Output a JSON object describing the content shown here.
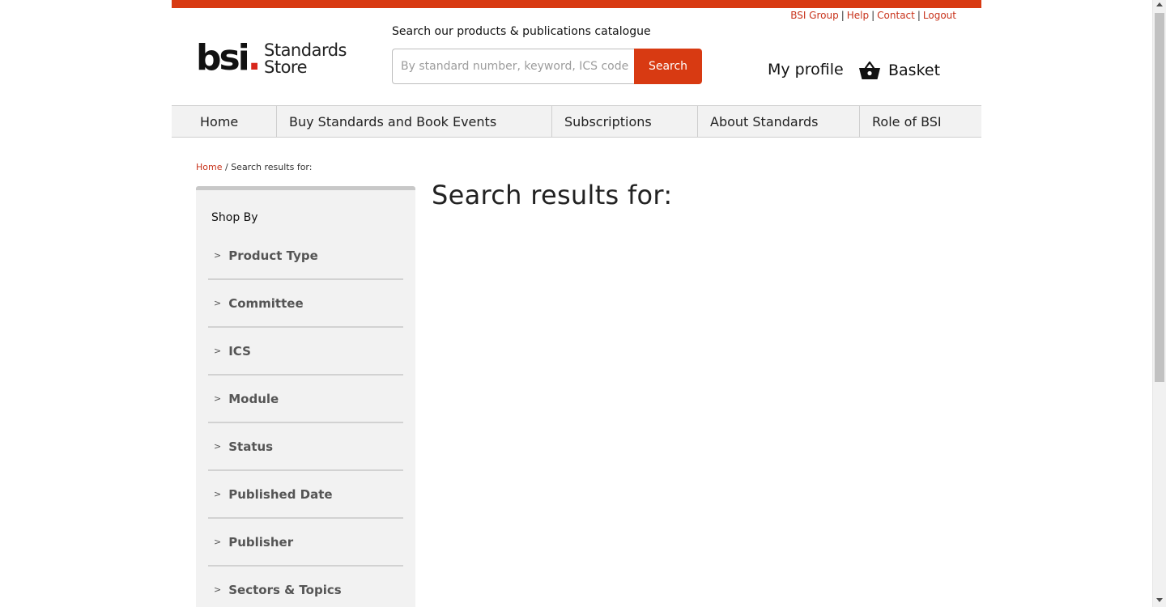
{
  "util_links": {
    "group": "BSI Group",
    "help": "Help",
    "contact": "Contact",
    "logout": "Logout",
    "separator": "|"
  },
  "logo": {
    "mark": "bsi",
    "dot": ".",
    "line1": "Standards",
    "line2": "Store",
    "brand_color": "#d8261b"
  },
  "search": {
    "label": "Search our products & publications catalogue",
    "placeholder": "By standard number, keyword, ICS code, ISBN",
    "value": "",
    "button_label": "Search"
  },
  "header": {
    "profile_label": "My profile",
    "basket_label": "Basket",
    "basket_icon": "basket-icon"
  },
  "nav": {
    "items": [
      {
        "label": "Home"
      },
      {
        "label": "Buy Standards and Book Events"
      },
      {
        "label": "Subscriptions"
      },
      {
        "label": "About Standards"
      },
      {
        "label": "Role of BSI"
      }
    ]
  },
  "breadcrumb": {
    "home": "Home",
    "separator": " / ",
    "current": "Search results for:"
  },
  "sidebar": {
    "title": "Shop By",
    "chevron": ">",
    "filters": [
      {
        "label": "Product Type"
      },
      {
        "label": "Committee"
      },
      {
        "label": "ICS"
      },
      {
        "label": "Module"
      },
      {
        "label": "Status"
      },
      {
        "label": "Published Date"
      },
      {
        "label": "Publisher"
      },
      {
        "label": "Sectors & Topics"
      }
    ]
  },
  "main": {
    "title": "Search results for:"
  },
  "colors": {
    "accent": "#d83a12",
    "link": "#c8321a",
    "nav_bg": "#f2f2f2",
    "sidebar_bg": "#f2f2f2"
  }
}
